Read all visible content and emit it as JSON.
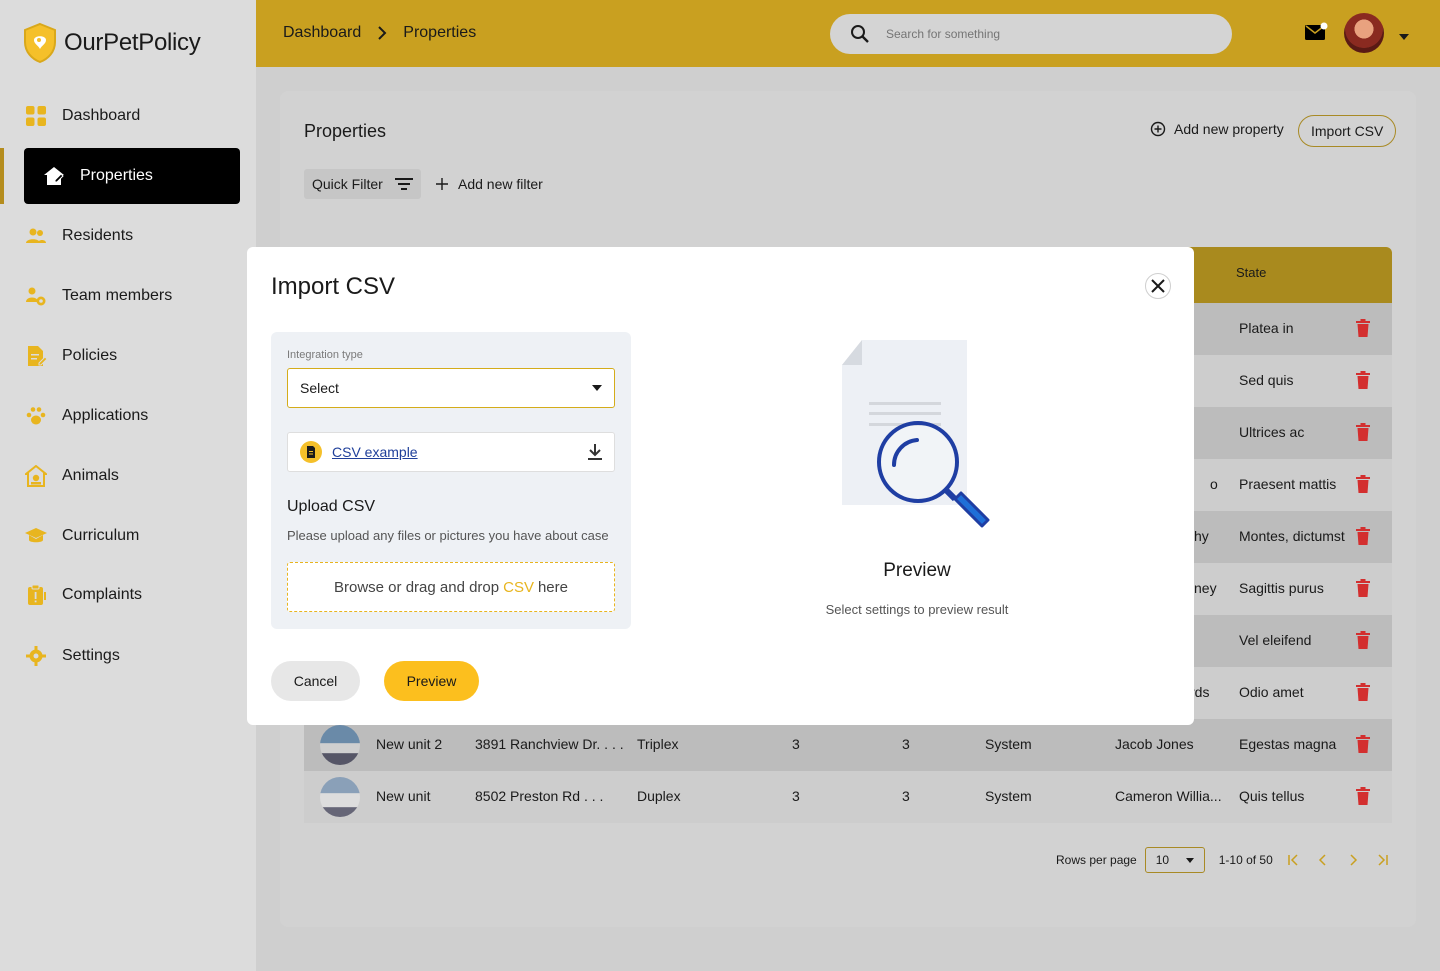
{
  "app": {
    "name": "OurPetPolicy"
  },
  "sidebar": {
    "items": [
      {
        "label": "Dashboard",
        "icon": "grid-icon"
      },
      {
        "label": "Properties",
        "icon": "home-edit-icon",
        "active": true
      },
      {
        "label": "Residents",
        "icon": "people-icon"
      },
      {
        "label": "Team members",
        "icon": "team-gear-icon"
      },
      {
        "label": "Policies",
        "icon": "document-edit-icon"
      },
      {
        "label": "Applications",
        "icon": "paw-icon"
      },
      {
        "label": "Animals",
        "icon": "pet-house-icon"
      },
      {
        "label": "Curriculum",
        "icon": "graduation-cap-icon"
      },
      {
        "label": "Complaints",
        "icon": "clipboard-alert-icon"
      },
      {
        "label": "Settings",
        "icon": "gear-icon"
      }
    ]
  },
  "header": {
    "breadcrumb": [
      "Dashboard",
      "Properties"
    ],
    "search_placeholder": "Search for something"
  },
  "page": {
    "title": "Properties",
    "add_property_label": "Add new property",
    "import_csv_label": "Import CSV",
    "quick_filter_label": "Quick Filter",
    "add_filter_label": "Add new filter",
    "table": {
      "state_header": "State",
      "rows": [
        {
          "partial": "",
          "state": "Platea in"
        },
        {
          "partial": "",
          "state": "Sed quis"
        },
        {
          "partial": "",
          "state": "Ultrices ac"
        },
        {
          "partial": "o",
          "state": "Praesent mattis"
        },
        {
          "partial": "hy",
          "state": "Montes, dictumst"
        },
        {
          "partial": "ney",
          "state": "Sagittis purus"
        },
        {
          "partial": "",
          "state": "Vel eleifend"
        },
        {
          "partial": "rds",
          "state": "Odio amet"
        },
        {
          "name": "New unit 2",
          "address": "3891 Ranchview Dr. . . .",
          "type": "Triplex",
          "c1": "3",
          "c2": "3",
          "source": "System",
          "owner": "Jacob Jones",
          "state": "Egestas magna"
        },
        {
          "name": "New unit",
          "address": "8502 Preston Rd . . .",
          "type": "Duplex",
          "c1": "3",
          "c2": "3",
          "source": "System",
          "owner": "Cameron Willia...",
          "state": "Quis tellus"
        }
      ]
    },
    "pagination": {
      "rows_per_page_label": "Rows per page",
      "rows_per_page": "10",
      "range": "1-10 of 50"
    }
  },
  "modal": {
    "title": "Import CSV",
    "integration_label": "Integration type",
    "integration_value": "Select",
    "csv_example_label": "CSV example",
    "upload_title": "Upload CSV",
    "upload_desc": "Please upload any files or pictures you have about case",
    "drop_prefix": "Browse or drag and drop",
    "drop_highlight": "CSV",
    "drop_suffix": "here",
    "cancel_label": "Cancel",
    "preview_button_label": "Preview",
    "preview_title": "Preview",
    "preview_desc": "Select settings to preview result"
  },
  "colors": {
    "brand_yellow": "#c9a020",
    "accent_yellow": "#fcbf1e",
    "delete_red": "#d32f2f",
    "link_blue": "#1f3f9a"
  }
}
